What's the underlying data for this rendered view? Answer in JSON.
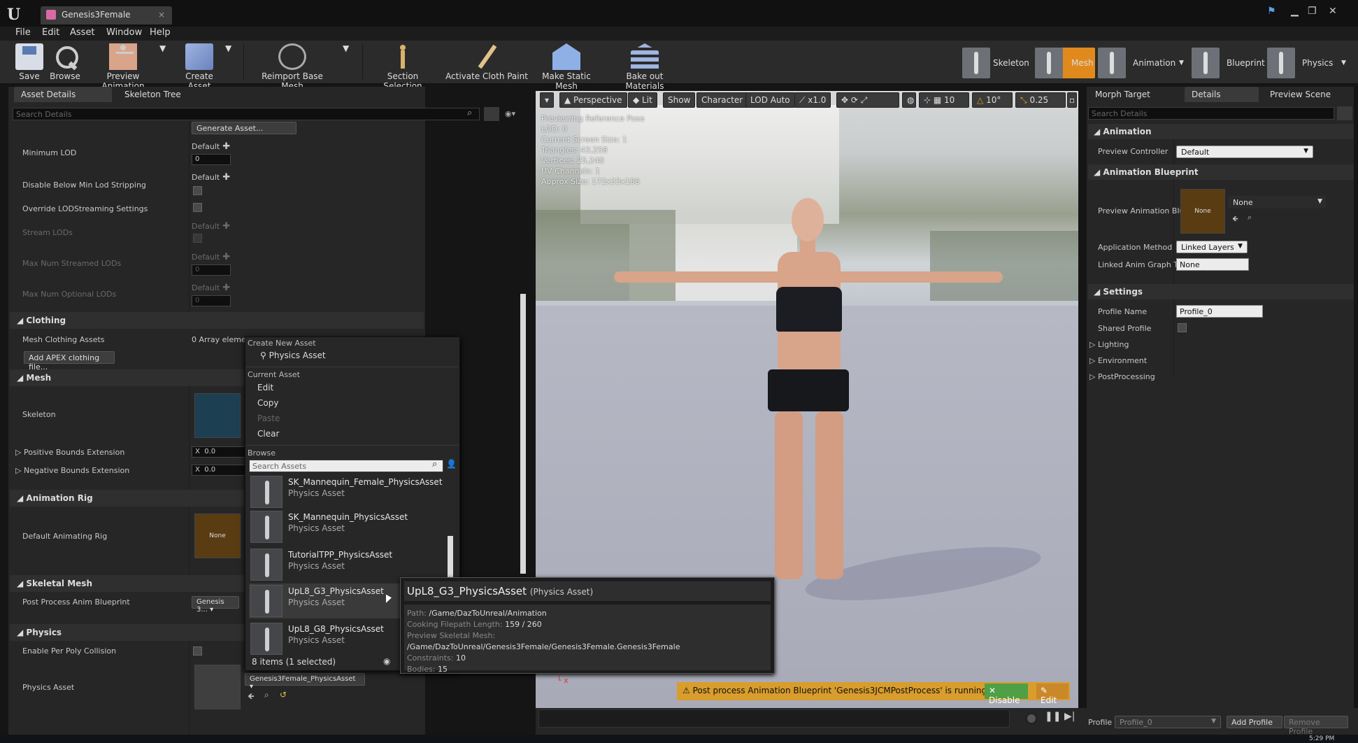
{
  "window": {
    "tab_title": "Genesis3Female",
    "close": "×"
  },
  "menu": [
    "File",
    "Edit",
    "Asset",
    "Window",
    "Help"
  ],
  "toolbar": {
    "save": "Save",
    "browse": "Browse",
    "preview_animation": "Preview Animation",
    "create_asset": "Create Asset",
    "reimport": "Reimport Base Mesh",
    "section_selection": "Section Selection",
    "activate_cloth": "Activate Cloth Paint",
    "make_static": "Make Static Mesh",
    "bake_out": "Bake out Materials"
  },
  "modes": {
    "skeleton": "Skeleton",
    "mesh": "Mesh",
    "animation": "Animation",
    "blueprint": "Blueprint",
    "physics": "Physics"
  },
  "left_panel": {
    "tab_asset": "Asset Details",
    "tab_skeleton": "Skeleton Tree",
    "search": "Search Details",
    "generate": "Generate Asset...",
    "rows": {
      "min_lod": "Minimum LOD",
      "disable_below": "Disable Below Min Lod Stripping",
      "override": "Override LODStreaming Settings",
      "stream": "Stream LODs",
      "max_streamed": "Max Num Streamed LODs",
      "max_optional": "Max Num Optional LODs"
    },
    "default": "Default",
    "zero": "0",
    "clothing": "Clothing",
    "mesh_clothing": "Mesh Clothing Assets",
    "array": "0 Array eleme",
    "apex": "Add APEX clothing file...",
    "mesh": "Mesh",
    "skeleton": "Skeleton",
    "pos_bounds": "Positive Bounds Extension",
    "neg_bounds": "Negative Bounds Extension",
    "x": "X",
    "x_val": "0.0",
    "anim_rig": "Animation Rig",
    "default_rig": "Default Animating Rig",
    "none": "None",
    "skel_mesh": "Skeletal Mesh",
    "post_process": "Post Process Anim Blueprint",
    "genesis": "Genesis 3...",
    "physics": "Physics",
    "per_poly": "Enable Per Poly Collision",
    "phys_asset": "Physics Asset",
    "phys_combo": "Genesis3Female_PhysicsAsset"
  },
  "context_menu": {
    "create_new": "Create New Asset",
    "physics_asset": "Physics Asset",
    "current": "Current Asset",
    "edit": "Edit",
    "copy": "Copy",
    "paste": "Paste",
    "clear": "Clear",
    "browse": "Browse",
    "search": "Search Assets",
    "items": [
      {
        "name": "SK_Mannequin_Female_PhysicsAsset",
        "kind": "Physics Asset"
      },
      {
        "name": "SK_Mannequin_PhysicsAsset",
        "kind": "Physics Asset"
      },
      {
        "name": "TutorialTPP_PhysicsAsset",
        "kind": "Physics Asset"
      },
      {
        "name": "UpL8_G3_PhysicsAsset",
        "kind": "Physics Asset"
      },
      {
        "name": "UpL8_G8_PhysicsAsset",
        "kind": "Physics Asset"
      }
    ],
    "count": "8 items (1 selected)"
  },
  "tooltip": {
    "title": "UpL8_G3_PhysicsAsset",
    "kind": "(Physics Asset)",
    "path_l": "Path:",
    "path": "/Game/DazToUnreal/Animation",
    "cook_l": "Cooking Filepath Length:",
    "cook": "159 / 260",
    "prev_l": "Preview Skeletal Mesh:",
    "prev": "/Game/DazToUnreal/Genesis3Female/Genesis3Female.Genesis3Female",
    "cons_l": "Constraints:",
    "cons": "10",
    "bodies_l": "Bodies:",
    "bodies": "15"
  },
  "viewport": {
    "perspective": "Perspective",
    "lit": "Lit",
    "show": "Show",
    "character": "Character",
    "lod": "LOD Auto",
    "speed": "x1.0",
    "grid": "10",
    "angle": "10°",
    "scale": "0.25",
    "info": [
      "Previewing Reference Pose",
      "LOD: 0",
      "Current Screen Size: 1",
      "Triangles: 43,258",
      "Vertices: 25,248",
      "UV Channels: 1",
      "Approx Size: 172x33x186"
    ],
    "notif": "Post process Animation Blueprint 'Genesis3JCMPostProcess' is running.",
    "disable": "Disable",
    "edit": "Edit"
  },
  "right_panel": {
    "tab_morph": "Morph Target",
    "tab_details": "Details",
    "tab_preview": "Preview Scene",
    "search": "Search Details",
    "animation": "Animation",
    "preview_controller": "Preview Controller",
    "default": "Default",
    "anim_bp": "Animation Blueprint",
    "preview_anim": "Preview Animation Blu",
    "none": "None",
    "app_method": "Application Method",
    "linked_layers": "Linked Layers",
    "linked_anim": "Linked Anim Graph Ta",
    "settings": "Settings",
    "profile_name": "Profile Name",
    "profile_val": "Profile_0",
    "shared": "Shared Profile",
    "lighting": "Lighting",
    "environment": "Environment",
    "postprocessing": "PostProcessing",
    "profile": "Profile",
    "add_profile": "Add Profile",
    "remove_profile": "Remove Profile"
  },
  "clock": "5:29 PM"
}
